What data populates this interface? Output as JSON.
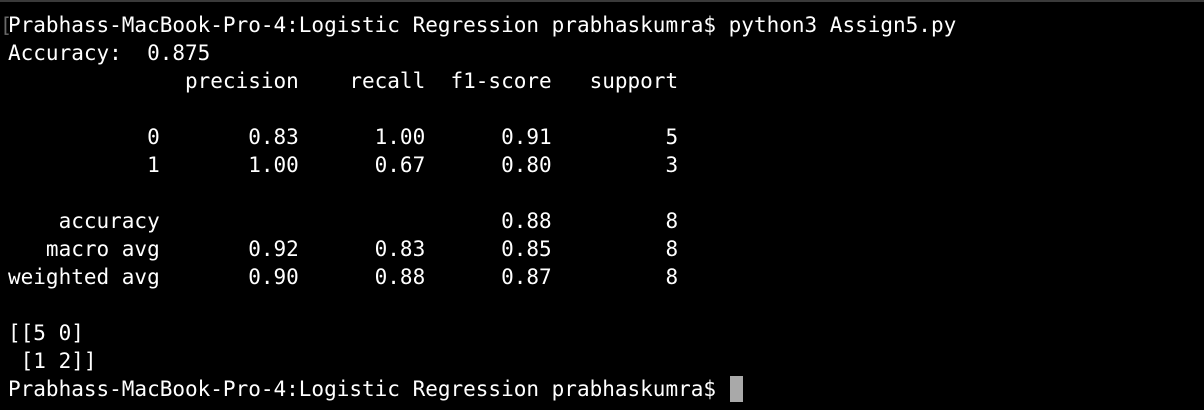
{
  "window": {
    "accent_background": "#000000",
    "text_color": "#ffffff",
    "cursor_color": "#a9a9a9"
  },
  "terminal": {
    "lines": [
      "Prabhass-MacBook-Pro-4:Logistic Regression prabhaskumra$ python3 Assign5.py",
      "Accuracy:  0.875",
      "              precision    recall  f1-score   support",
      "",
      "           0       0.83      1.00      0.91         5",
      "           1       1.00      0.67      0.80         3",
      "",
      "    accuracy                           0.88         8",
      "   macro avg       0.92      0.83      0.85         8",
      "weighted avg       0.90      0.88      0.87         8",
      "",
      "[[5 0]",
      " [1 2]]"
    ],
    "prompt": "Prabhass-MacBook-Pro-4:Logistic Regression prabhaskumra$ "
  }
}
